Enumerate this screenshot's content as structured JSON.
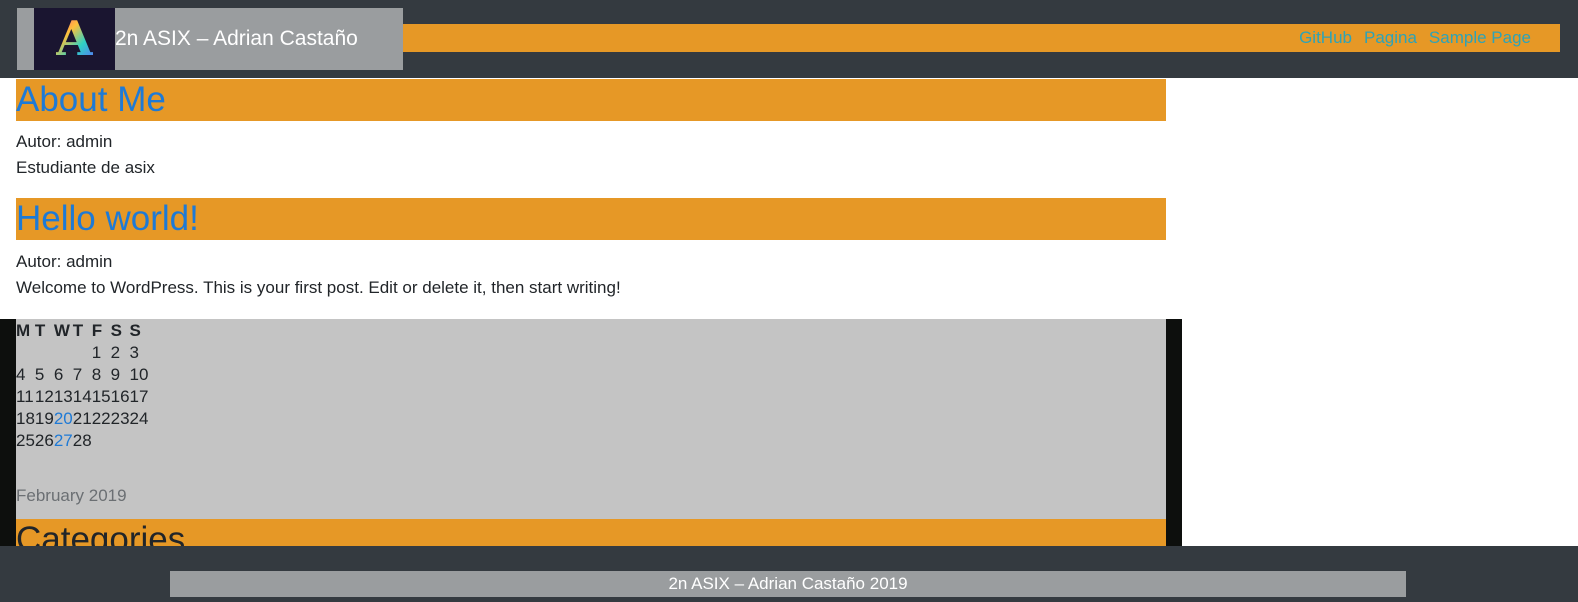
{
  "header": {
    "site_title": "2n ASIX – Adrian Castaño",
    "logo_letter": "A",
    "nav": [
      "GitHub",
      "Pagina",
      "Sample Page"
    ]
  },
  "posts": [
    {
      "title": "About Me",
      "author": "Autor: admin",
      "content": "Estudiante de asix"
    },
    {
      "title": "Hello world!",
      "author": "Autor: admin",
      "content": "Welcome to WordPress. This is your first post. Edit or delete it, then start writing!"
    }
  ],
  "calendar": {
    "headers": [
      "M",
      "T",
      "W",
      "T",
      "F",
      "S",
      "S"
    ],
    "rows": [
      [
        "",
        "",
        "",
        "",
        "1",
        "2",
        "3"
      ],
      [
        "4",
        "5",
        "6",
        "7",
        "8",
        "9",
        "10"
      ],
      [
        "11",
        "12",
        "13",
        "14",
        "15",
        "16",
        "17"
      ],
      [
        "18",
        "19",
        "20",
        "21",
        "22",
        "23",
        "24"
      ],
      [
        "25",
        "26",
        "27",
        "28",
        "",
        "",
        ""
      ]
    ],
    "linked_days": [
      "20",
      "27"
    ],
    "caption": "February 2019"
  },
  "widgets": {
    "categories_title": "Categories"
  },
  "footer": {
    "text": "2n ASIX – Adrian Castaño 2019"
  },
  "colors": {
    "header_bg": "#343a40",
    "accent_orange": "#e69826",
    "link_blue": "#1e7ad6",
    "nav_link": "#2da3b8",
    "widget_bg": "#c4c4c4"
  }
}
